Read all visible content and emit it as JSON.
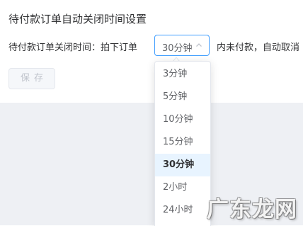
{
  "section": {
    "title": "待付款订单自动关闭时间设置"
  },
  "close_setting": {
    "label": "待付款订单关闭时间：拍下订单",
    "selected_value": "30分钟",
    "suffix_text": "内未付款，自动取消"
  },
  "save_button": {
    "label": "保存"
  },
  "dropdown": {
    "options": [
      "3分钟",
      "5分钟",
      "10分钟",
      "15分钟",
      "30分钟",
      "2小时",
      "24小时"
    ],
    "selected_index": 4
  },
  "watermark": {
    "text": "广东龙网"
  },
  "colors": {
    "accent": "#409eff",
    "selected_option_bg": "#e8f4ff",
    "page_bottom_bg": "#eef0f4"
  },
  "icons": {
    "select_arrow": "chevron-up-icon"
  }
}
